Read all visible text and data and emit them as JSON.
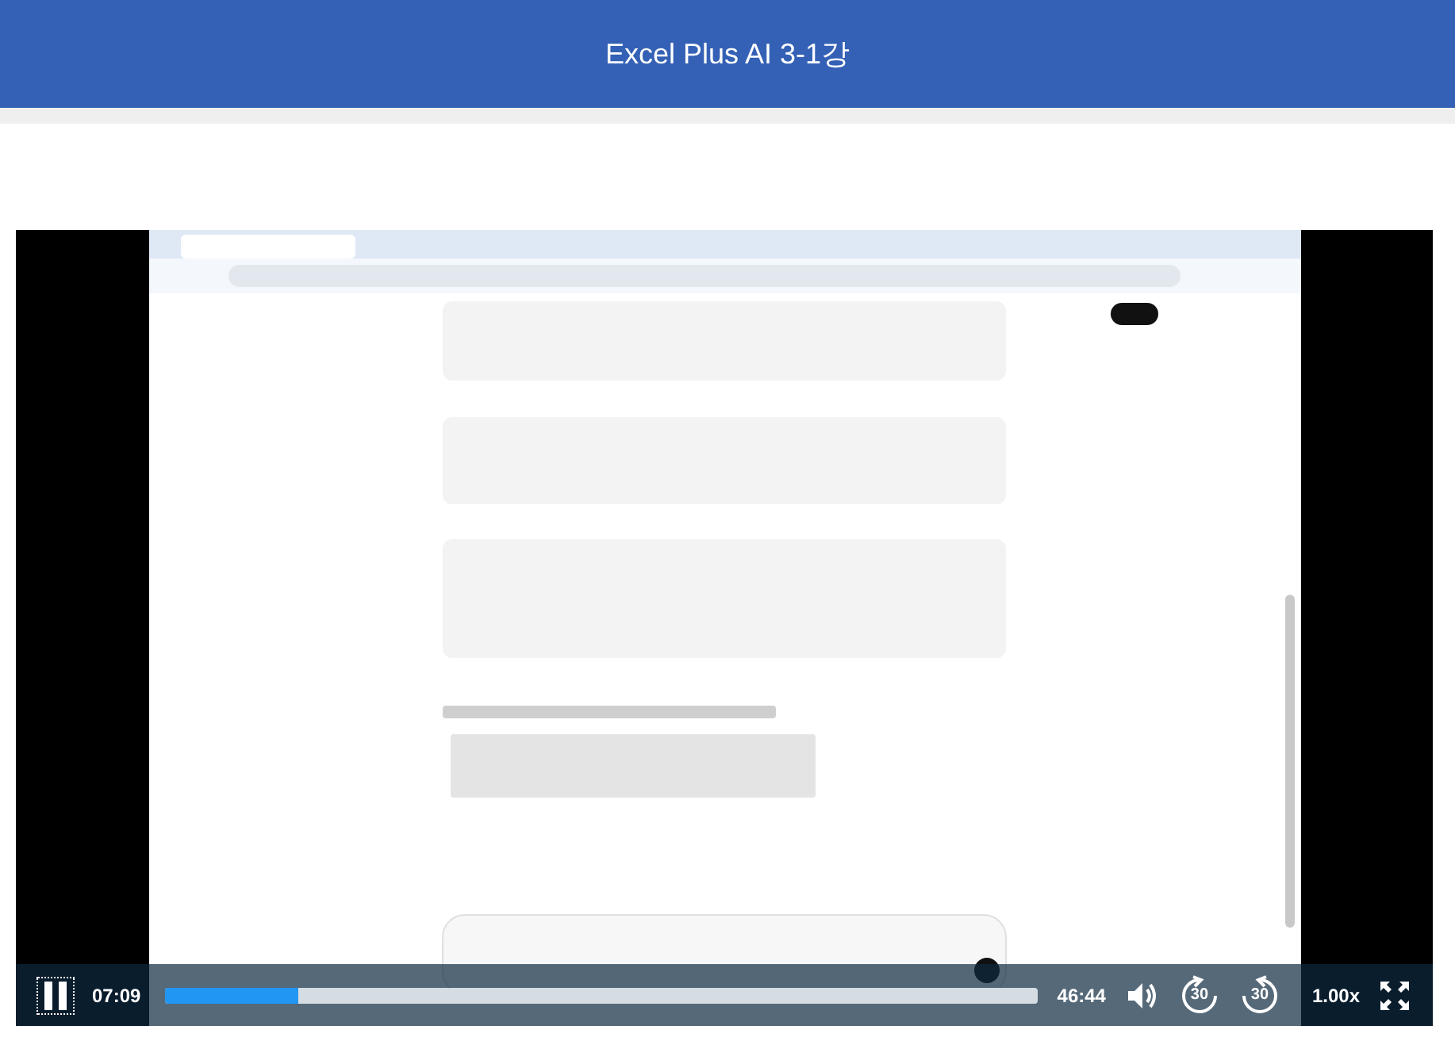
{
  "header": {
    "title": "Excel Plus AI 3-1강"
  },
  "player": {
    "playing": true,
    "current_time": "07:09",
    "progress": {
      "level": 0.153
    },
    "duration": "46:44",
    "rewind_label": "30",
    "forward_label": "30",
    "speed": "1.00x"
  }
}
